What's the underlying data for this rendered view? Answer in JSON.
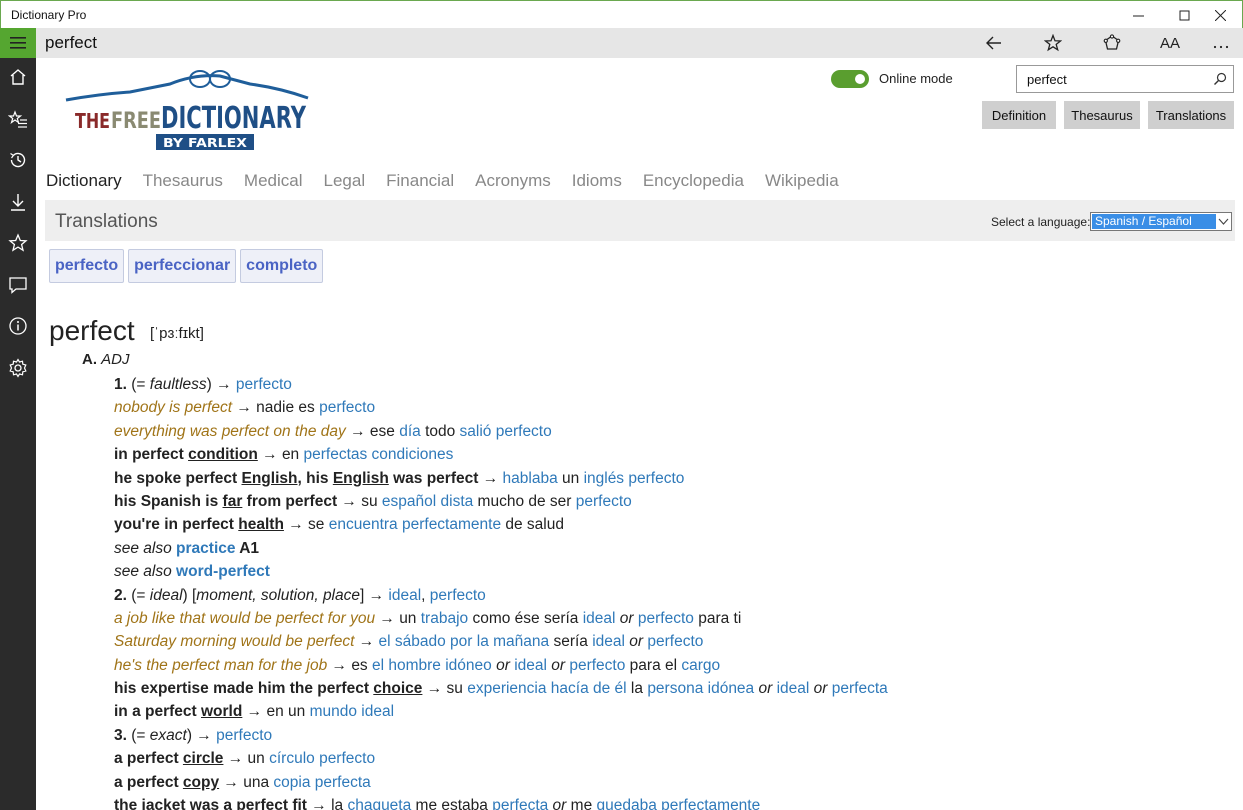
{
  "window": {
    "title": "Dictionary Pro",
    "minimize_icon": "minimize-icon",
    "maximize_icon": "maximize-icon",
    "close_icon": "close-icon"
  },
  "rail": {
    "items": [
      "menu-icon",
      "home-icon",
      "favorites-list-icon",
      "history-icon",
      "download-icon",
      "star-icon",
      "feedback-icon",
      "info-icon",
      "settings-icon"
    ]
  },
  "command_bar": {
    "word": "perfect",
    "aa_label": "AA"
  },
  "header": {
    "logo_text": "THE FREE DICTIONARY BY FARLEX",
    "online_mode_label": "Online mode",
    "online_mode_on": true,
    "search_value": "perfect",
    "buttons": [
      "Definition",
      "Thesaurus",
      "Translations"
    ]
  },
  "tabs": [
    "Dictionary",
    "Thesaurus",
    "Medical",
    "Legal",
    "Financial",
    "Acronyms",
    "Idioms",
    "Encyclopedia",
    "Wikipedia"
  ],
  "translations": {
    "heading": "Translations",
    "language_label": "Select a language:",
    "language_value": "Spanish / Español",
    "chips": [
      "perfecto",
      "perfeccionar",
      "completo"
    ]
  },
  "entry": {
    "headword": "perfect",
    "pronunciation": "[ˈpɜːfɪkt]",
    "pos_letter": "A.",
    "pos": "ADJ",
    "lines": [
      [
        [
          "b",
          "1."
        ],
        [
          "t",
          " (= "
        ],
        [
          "it",
          "faultless"
        ],
        [
          "t",
          ") → "
        ],
        [
          "lk",
          "perfecto"
        ]
      ],
      [
        [
          "ex",
          "nobody is perfect"
        ],
        [
          "t",
          " → nadie es "
        ],
        [
          "lk",
          "perfecto"
        ]
      ],
      [
        [
          "ex",
          "everything was perfect on the day"
        ],
        [
          "t",
          " → ese "
        ],
        [
          "lk",
          "día"
        ],
        [
          "t",
          " todo "
        ],
        [
          "lk",
          "salió perfecto"
        ]
      ],
      [
        [
          "b",
          "in perfect "
        ],
        [
          "u",
          "condition"
        ],
        [
          "t",
          " → en "
        ],
        [
          "lk",
          "perfectas condiciones"
        ]
      ],
      [
        [
          "b",
          "he spoke perfect "
        ],
        [
          "u",
          "English"
        ],
        [
          "b",
          ", his "
        ],
        [
          "u",
          "English"
        ],
        [
          "b",
          " was perfect"
        ],
        [
          "t",
          " → "
        ],
        [
          "lk",
          "hablaba"
        ],
        [
          "t",
          " un "
        ],
        [
          "lk",
          "inglés perfecto"
        ]
      ],
      [
        [
          "b",
          "his Spanish is "
        ],
        [
          "u",
          "far"
        ],
        [
          "b",
          " from perfect"
        ],
        [
          "t",
          " → su "
        ],
        [
          "lk",
          "español dista"
        ],
        [
          "t",
          " mucho de ser "
        ],
        [
          "lk",
          "perfecto"
        ]
      ],
      [
        [
          "b",
          "you're in perfect "
        ],
        [
          "u",
          "health"
        ],
        [
          "t",
          " → se "
        ],
        [
          "lk",
          "encuentra perfectamente"
        ],
        [
          "t",
          " de salud"
        ]
      ],
      [
        [
          "it",
          "see also "
        ],
        [
          "lkb",
          "practice"
        ],
        [
          "b",
          " A1"
        ]
      ],
      [
        [
          "it",
          "see also "
        ],
        [
          "lkb",
          "word-perfect"
        ]
      ],
      [
        [
          "b",
          "2."
        ],
        [
          "t",
          " (= "
        ],
        [
          "it",
          "ideal"
        ],
        [
          "t",
          ") ["
        ],
        [
          "it",
          "moment, solution, place"
        ],
        [
          "t",
          "] → "
        ],
        [
          "lk",
          "ideal"
        ],
        [
          "t",
          ", "
        ],
        [
          "lk",
          "perfecto"
        ]
      ],
      [
        [
          "ex",
          "a job like that would be perfect for you"
        ],
        [
          "t",
          " → un "
        ],
        [
          "lk",
          "trabajo"
        ],
        [
          "t",
          " como ése sería "
        ],
        [
          "lk",
          "ideal"
        ],
        [
          "it",
          " or "
        ],
        [
          "lk",
          "perfecto"
        ],
        [
          "t",
          " para ti"
        ]
      ],
      [
        [
          "ex",
          "Saturday morning would be perfect"
        ],
        [
          "t",
          " → "
        ],
        [
          "lk",
          "el sábado por la mañana"
        ],
        [
          "t",
          " sería "
        ],
        [
          "lk",
          "ideal"
        ],
        [
          "it",
          " or "
        ],
        [
          "lk",
          "perfecto"
        ]
      ],
      [
        [
          "ex",
          "he's the perfect man for the job"
        ],
        [
          "t",
          " → es "
        ],
        [
          "lk",
          "el hombre idóneo"
        ],
        [
          "it",
          " or "
        ],
        [
          "lk",
          "ideal"
        ],
        [
          "it",
          " or "
        ],
        [
          "lk",
          "perfecto"
        ],
        [
          "t",
          " para el "
        ],
        [
          "lk",
          "cargo"
        ]
      ],
      [
        [
          "b",
          "his expertise made him the perfect "
        ],
        [
          "u",
          "choice"
        ],
        [
          "t",
          " → su "
        ],
        [
          "lk",
          "experiencia hacía de él"
        ],
        [
          "t",
          " la "
        ],
        [
          "lk",
          "persona idónea"
        ],
        [
          "it",
          " or "
        ],
        [
          "lk",
          "ideal"
        ],
        [
          "it",
          " or "
        ],
        [
          "lk",
          "perfecta"
        ]
      ],
      [
        [
          "b",
          "in a perfect "
        ],
        [
          "u",
          "world"
        ],
        [
          "t",
          " → en un "
        ],
        [
          "lk",
          "mundo ideal"
        ]
      ],
      [
        [
          "b",
          "3."
        ],
        [
          "t",
          " (= "
        ],
        [
          "it",
          "exact"
        ],
        [
          "t",
          ") → "
        ],
        [
          "lk",
          "perfecto"
        ]
      ],
      [
        [
          "b",
          "a perfect "
        ],
        [
          "u",
          "circle"
        ],
        [
          "t",
          " → un "
        ],
        [
          "lk",
          "círculo perfecto"
        ]
      ],
      [
        [
          "b",
          "a perfect "
        ],
        [
          "u",
          "copy"
        ],
        [
          "t",
          " → una "
        ],
        [
          "lk",
          "copia perfecta"
        ]
      ],
      [
        [
          "b",
          "the jacket was a perfect fit"
        ],
        [
          "t",
          " → la "
        ],
        [
          "lk",
          "chaqueta"
        ],
        [
          "t",
          " me estaba "
        ],
        [
          "lk",
          "perfecta"
        ],
        [
          "it",
          " or "
        ],
        [
          "t",
          "me "
        ],
        [
          "lk",
          "quedaba perfectamente"
        ]
      ]
    ]
  }
}
